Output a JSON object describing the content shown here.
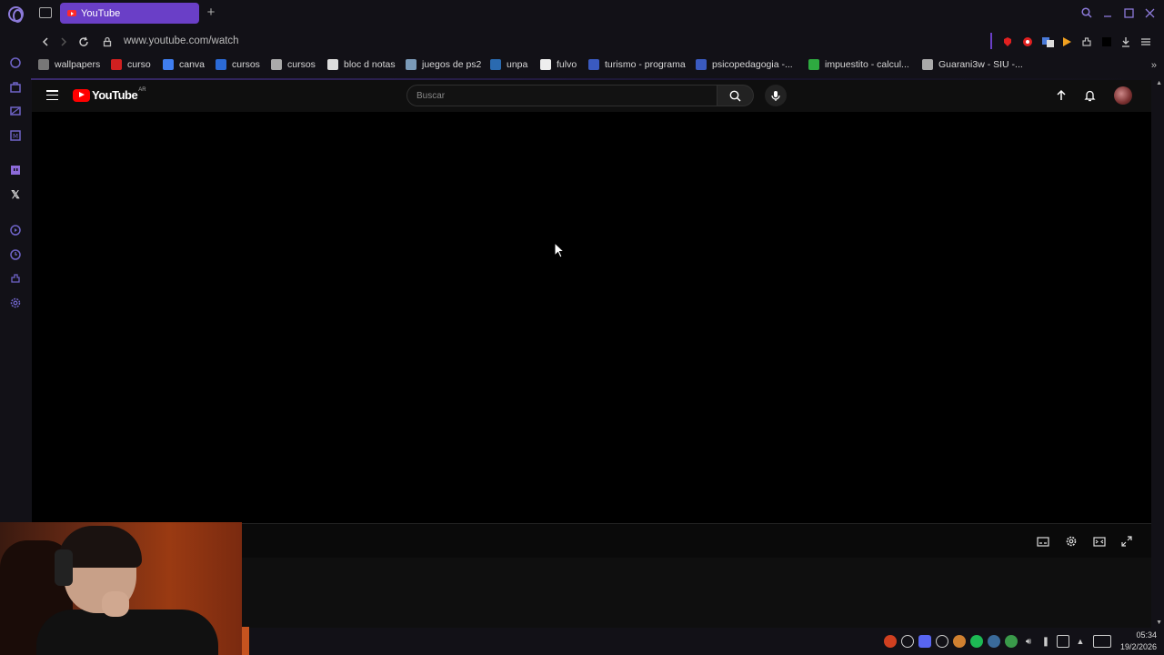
{
  "browser": {
    "tab": {
      "title": "YouTube"
    },
    "address": {
      "url": "www.youtube.com/watch"
    },
    "bookmarks": [
      {
        "label": "wallpapers",
        "icon": "wallpaper-icon",
        "color": "#777"
      },
      {
        "label": "curso",
        "icon": "curso-icon",
        "color": "#d02020"
      },
      {
        "label": "canva",
        "icon": "canva-icon",
        "color": "#3f7ef0"
      },
      {
        "label": "cursos",
        "icon": "cursos-c-icon",
        "color": "#2b6ad6"
      },
      {
        "label": "cursos",
        "icon": "cursos-doc-icon",
        "color": "#aaa"
      },
      {
        "label": "bloc d notas",
        "icon": "notepad-icon",
        "color": "#ddd"
      },
      {
        "label": "juegos de ps2",
        "icon": "ps2-icon",
        "color": "#7a9ab8"
      },
      {
        "label": "unpa",
        "icon": "unpa-icon",
        "color": "#2a6ab0"
      },
      {
        "label": "fulvo",
        "icon": "soccer-ball-icon",
        "color": "#eee"
      },
      {
        "label": "turismo - programa",
        "icon": "turismo-icon",
        "color": "#3a5ac0"
      },
      {
        "label": "psicopedagogia -...",
        "icon": "psicopedagogia-icon",
        "color": "#3a5ac0"
      },
      {
        "label": "impuestito - calcul...",
        "icon": "calculator-icon",
        "color": "#2eaa40"
      },
      {
        "label": "Guarani3w - SIU -...",
        "icon": "page-icon",
        "color": "#aaa"
      }
    ]
  },
  "youtube": {
    "logo_text": "YouTube",
    "country_code": "AR",
    "search_placeholder": "Buscar"
  },
  "taskbar": {
    "time": "05:34",
    "date": "19/2/2026"
  },
  "colors": {
    "accent": "#6a3fc7",
    "youtube_red": "#ff0000"
  }
}
